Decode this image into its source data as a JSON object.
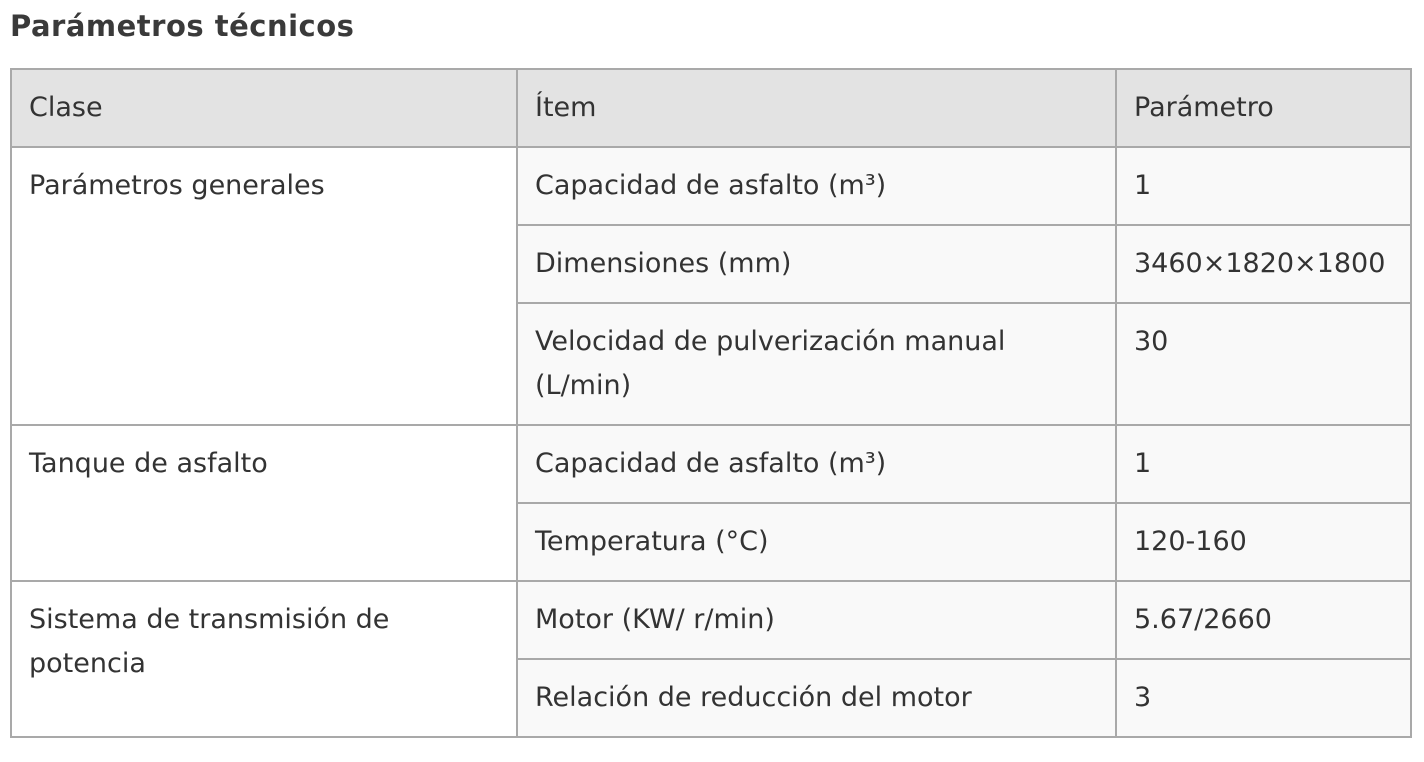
{
  "title": "Parámetros técnicos",
  "table": {
    "headers": [
      "Clase",
      "Ítem",
      "Parámetro"
    ],
    "groups": [
      {
        "clase": "Parámetros generales",
        "rows": [
          {
            "item": "Capacidad de asfalto (m³)",
            "param": "1"
          },
          {
            "item": "Dimensiones (mm)",
            "param": "3460×1820×1800"
          },
          {
            "item": "Velocidad de pulverización manual (L/min)",
            "param": "30"
          }
        ]
      },
      {
        "clase": "Tanque de asfalto",
        "rows": [
          {
            "item": "Capacidad de asfalto (m³)",
            "param": "1"
          },
          {
            "item": "Temperatura (°C)",
            "param": "120-160"
          }
        ]
      },
      {
        "clase": "Sistema de transmisión de potencia",
        "rows": [
          {
            "item": "Motor (KW/ r/min)",
            "param": "5.67/2660"
          },
          {
            "item": "Relación de reducción del motor",
            "param": "3"
          }
        ]
      }
    ]
  }
}
